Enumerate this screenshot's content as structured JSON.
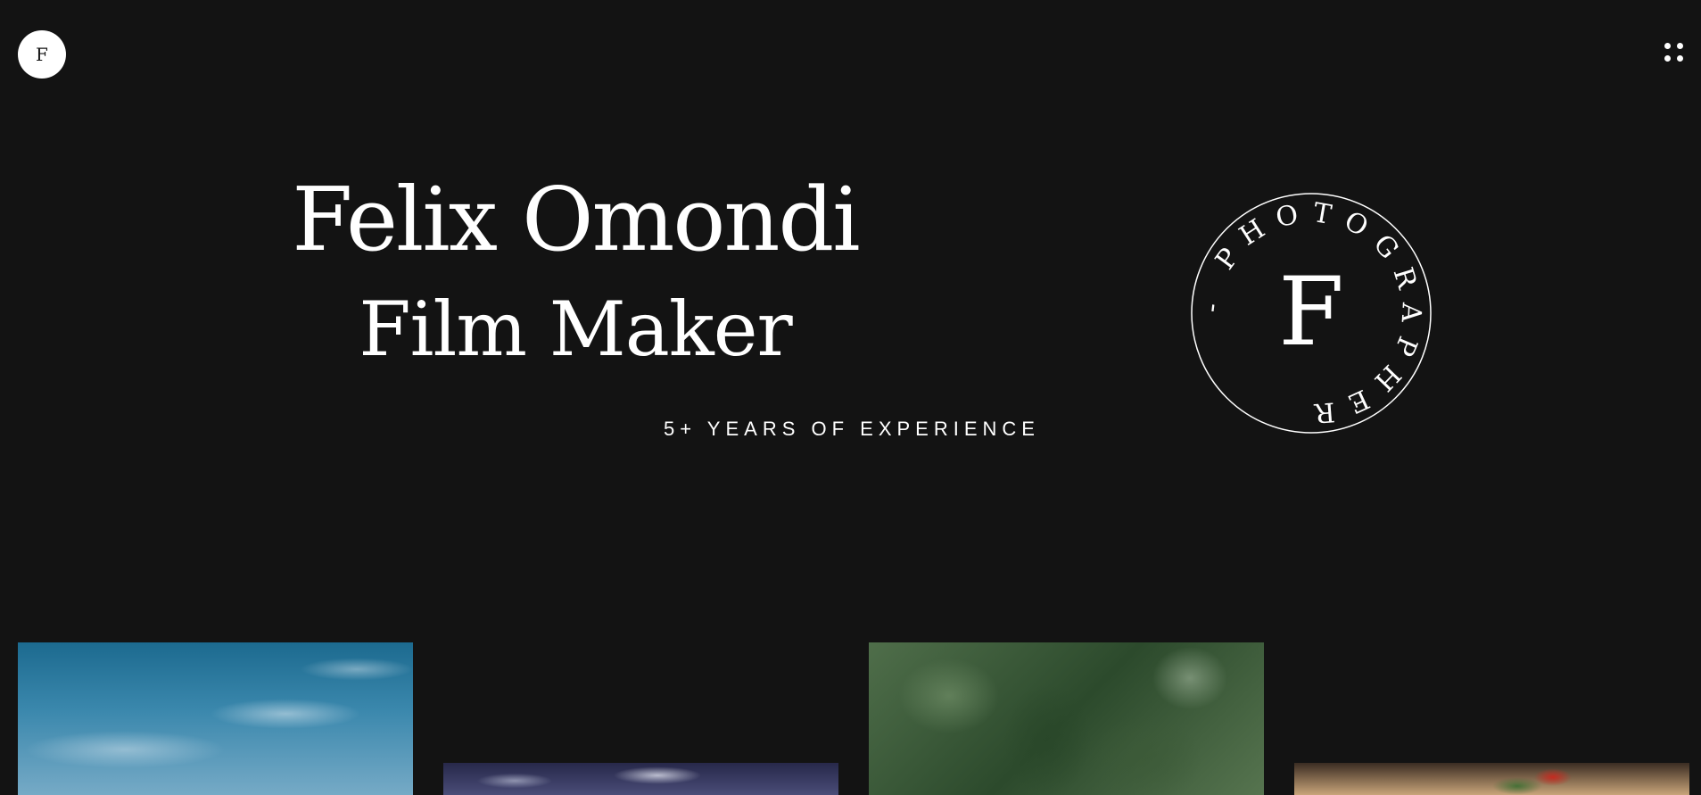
{
  "header": {
    "logo_letter": "F"
  },
  "hero": {
    "name": "Felix Omondi",
    "role": "Film Maker",
    "experience": "5+ YEARS OF EXPERIENCE"
  },
  "stamp": {
    "letter": "F",
    "ring_text": "- PHOTOGRAPHER"
  },
  "gallery": {
    "items": [
      "sky-photo",
      "clouds-photo",
      "palm-leaves-photo",
      "food-photo"
    ]
  },
  "colors": {
    "background": "#131313",
    "foreground": "#ffffff"
  }
}
